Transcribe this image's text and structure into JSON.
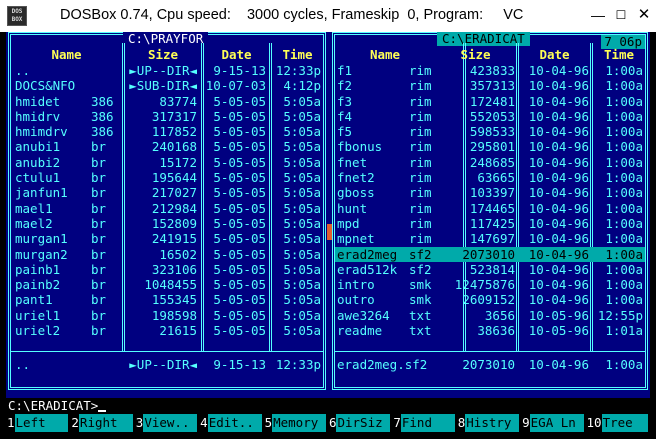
{
  "window": {
    "icon_text_top": "DOS",
    "icon_text_bottom": "BOX",
    "title": "DOSBox 0.74, Cpu speed:    3000 cycles, Frameskip  0, Program:     VC",
    "minimize_glyph": "—",
    "maximize_glyph": "☐",
    "close_glyph": "✕"
  },
  "colors": {
    "screen_bg": "#000080",
    "text_cyan": "#55ffff",
    "header_yellow": "#ffff55",
    "highlight_teal": "#00aaaa"
  },
  "columns": {
    "name": "Name",
    "size": "Size",
    "date": "Date",
    "time": "Time"
  },
  "left_panel": {
    "path": "C:\\PRAYFOR",
    "rows": [
      {
        "name": "..",
        "ext": "",
        "size": "►UP--DIR◄",
        "date": "9-15-13",
        "time": "12:33p"
      },
      {
        "name": "DOCS&NFO",
        "ext": "",
        "size": "►SUB-DIR◄",
        "date": "10-07-03",
        "time": "4:12p"
      },
      {
        "name": "hmidet",
        "ext": "386",
        "size": "83774",
        "date": "5-05-05",
        "time": "5:05a"
      },
      {
        "name": "hmidrv",
        "ext": "386",
        "size": "317317",
        "date": "5-05-05",
        "time": "5:05a"
      },
      {
        "name": "hmimdrv",
        "ext": "386",
        "size": "117852",
        "date": "5-05-05",
        "time": "5:05a"
      },
      {
        "name": "anubi1",
        "ext": "br",
        "size": "240168",
        "date": "5-05-05",
        "time": "5:05a"
      },
      {
        "name": "anubi2",
        "ext": "br",
        "size": "15172",
        "date": "5-05-05",
        "time": "5:05a"
      },
      {
        "name": "ctulu1",
        "ext": "br",
        "size": "195644",
        "date": "5-05-05",
        "time": "5:05a"
      },
      {
        "name": "janfun1",
        "ext": "br",
        "size": "217027",
        "date": "5-05-05",
        "time": "5:05a"
      },
      {
        "name": "mael1",
        "ext": "br",
        "size": "212984",
        "date": "5-05-05",
        "time": "5:05a"
      },
      {
        "name": "mael2",
        "ext": "br",
        "size": "152809",
        "date": "5-05-05",
        "time": "5:05a"
      },
      {
        "name": "murgan1",
        "ext": "br",
        "size": "241915",
        "date": "5-05-05",
        "time": "5:05a"
      },
      {
        "name": "murgan2",
        "ext": "br",
        "size": "16502",
        "date": "5-05-05",
        "time": "5:05a"
      },
      {
        "name": "painb1",
        "ext": "br",
        "size": "323106",
        "date": "5-05-05",
        "time": "5:05a"
      },
      {
        "name": "painb2",
        "ext": "br",
        "size": "1048455",
        "date": "5-05-05",
        "time": "5:05a"
      },
      {
        "name": "pant1",
        "ext": "br",
        "size": "155345",
        "date": "5-05-05",
        "time": "5:05a"
      },
      {
        "name": "uriel1",
        "ext": "br",
        "size": "198598",
        "date": "5-05-05",
        "time": "5:05a"
      },
      {
        "name": "uriel2",
        "ext": "br",
        "size": "21615",
        "date": "5-05-05",
        "time": "5:05a"
      }
    ],
    "footer": {
      "name": "..",
      "size": "►UP--DIR◄",
      "date": "9-15-13",
      "time": "12:33p"
    }
  },
  "right_panel": {
    "path": "C:\\ERADICAT",
    "clock": "7 06p",
    "selected_index": 13,
    "rows": [
      {
        "name": "f1",
        "ext": "rim",
        "size": "423833",
        "date": "10-04-96",
        "time": "1:00a"
      },
      {
        "name": "f2",
        "ext": "rim",
        "size": "357313",
        "date": "10-04-96",
        "time": "1:00a"
      },
      {
        "name": "f3",
        "ext": "rim",
        "size": "172481",
        "date": "10-04-96",
        "time": "1:00a"
      },
      {
        "name": "f4",
        "ext": "rim",
        "size": "552053",
        "date": "10-04-96",
        "time": "1:00a"
      },
      {
        "name": "f5",
        "ext": "rim",
        "size": "598533",
        "date": "10-04-96",
        "time": "1:00a"
      },
      {
        "name": "fbonus",
        "ext": "rim",
        "size": "295801",
        "date": "10-04-96",
        "time": "1:00a"
      },
      {
        "name": "fnet",
        "ext": "rim",
        "size": "248685",
        "date": "10-04-96",
        "time": "1:00a"
      },
      {
        "name": "fnet2",
        "ext": "rim",
        "size": "63665",
        "date": "10-04-96",
        "time": "1:00a"
      },
      {
        "name": "gboss",
        "ext": "rim",
        "size": "103397",
        "date": "10-04-96",
        "time": "1:00a"
      },
      {
        "name": "hunt",
        "ext": "rim",
        "size": "174465",
        "date": "10-04-96",
        "time": "1:00a"
      },
      {
        "name": "mpd",
        "ext": "rim",
        "size": "117425",
        "date": "10-04-96",
        "time": "1:00a"
      },
      {
        "name": "mpnet",
        "ext": "rim",
        "size": "147697",
        "date": "10-04-96",
        "time": "1:00a"
      },
      {
        "name": "erad2meg",
        "ext": "sf2",
        "size": "2073010",
        "date": "10-04-96",
        "time": "1:00a"
      },
      {
        "name": "erad512k",
        "ext": "sf2",
        "size": "523814",
        "date": "10-04-96",
        "time": "1:00a"
      },
      {
        "name": "intro",
        "ext": "smk",
        "size": "12475876",
        "date": "10-04-96",
        "time": "1:00a"
      },
      {
        "name": "outro",
        "ext": "smk",
        "size": "2609152",
        "date": "10-04-96",
        "time": "1:00a"
      },
      {
        "name": "awe3264",
        "ext": "txt",
        "size": "3656",
        "date": "10-05-96",
        "time": "12:55p"
      },
      {
        "name": "readme",
        "ext": "txt",
        "size": "38636",
        "date": "10-05-96",
        "time": "1:01a"
      }
    ],
    "footer": {
      "name": "erad2meg.sf2",
      "size": "2073010",
      "date": "10-04-96",
      "time": "1:00a"
    }
  },
  "command_line": {
    "prompt": "C:\\ERADICAT>"
  },
  "function_keys": [
    {
      "num": "1",
      "label": "Left"
    },
    {
      "num": "2",
      "label": "Right"
    },
    {
      "num": "3",
      "label": "View.."
    },
    {
      "num": "4",
      "label": "Edit.."
    },
    {
      "num": "5",
      "label": "Memory"
    },
    {
      "num": "6",
      "label": "DirSiz"
    },
    {
      "num": "7",
      "label": "Find"
    },
    {
      "num": "8",
      "label": "Histry"
    },
    {
      "num": "9",
      "label": "EGA Ln"
    },
    {
      "num": "10",
      "label": "Tree"
    }
  ]
}
